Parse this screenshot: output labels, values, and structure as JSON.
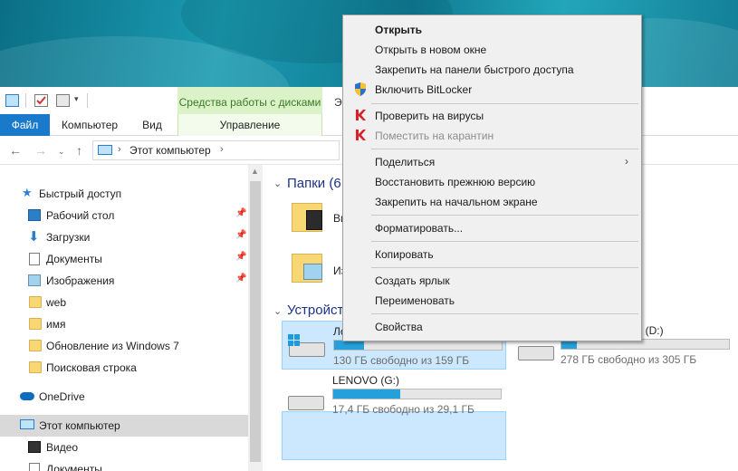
{
  "ribbon": {
    "contextual_group": "Средства работы с дисками",
    "title_cut": "Э",
    "tabs": {
      "file": "Файл",
      "computer": "Компьютер",
      "view": "Вид",
      "manage": "Управление"
    }
  },
  "address": {
    "path": "Этот компьютер"
  },
  "nav": {
    "quick_access": "Быстрый доступ",
    "items": [
      "Рабочий стол",
      "Загрузки",
      "Документы",
      "Изображения",
      "web",
      "имя",
      "Обновление из Windows 7",
      "Поисковая строка"
    ],
    "onedrive": "OneDrive",
    "this_pc": "Этот компьютер",
    "video": "Видео",
    "documents": "Документы"
  },
  "content": {
    "folders_header": "Папки (6",
    "folder1": "Ви",
    "folder2": "Из",
    "devices_header": "Устройст",
    "drives": [
      {
        "name": "Ло",
        "free": "130 ГБ свободно из 159 ГБ",
        "used_fraction": 0.18,
        "selected": true
      },
      {
        "name": "к (D:)",
        "free": "278 ГБ свободно из 305 ГБ",
        "used_fraction": 0.09,
        "selected": false
      },
      {
        "name": "LENOVO (G:)",
        "free": "17,4 ГБ свободно из 29,1 ГБ",
        "used_fraction": 0.4,
        "selected": false
      }
    ]
  },
  "menu": {
    "open": "Открыть",
    "open_new_window": "Открыть в новом окне",
    "pin_quick": "Закрепить на панели быстрого доступа",
    "bitlocker": "Включить BitLocker",
    "scan": "Проверить на вирусы",
    "quarantine": "Поместить на карантин",
    "share": "Поделиться",
    "restore": "Восстановить прежнюю версию",
    "pin_start": "Закрепить на начальном экране",
    "format": "Форматировать...",
    "copy": "Копировать",
    "shortcut": "Создать ярлык",
    "rename": "Переименовать",
    "properties": "Свойства"
  },
  "colors": {
    "accent": "#1979ca",
    "disk_tools": "#dbf2c8",
    "drive_bar": "#26a0da",
    "menu_bg": "#f0f0f0"
  }
}
